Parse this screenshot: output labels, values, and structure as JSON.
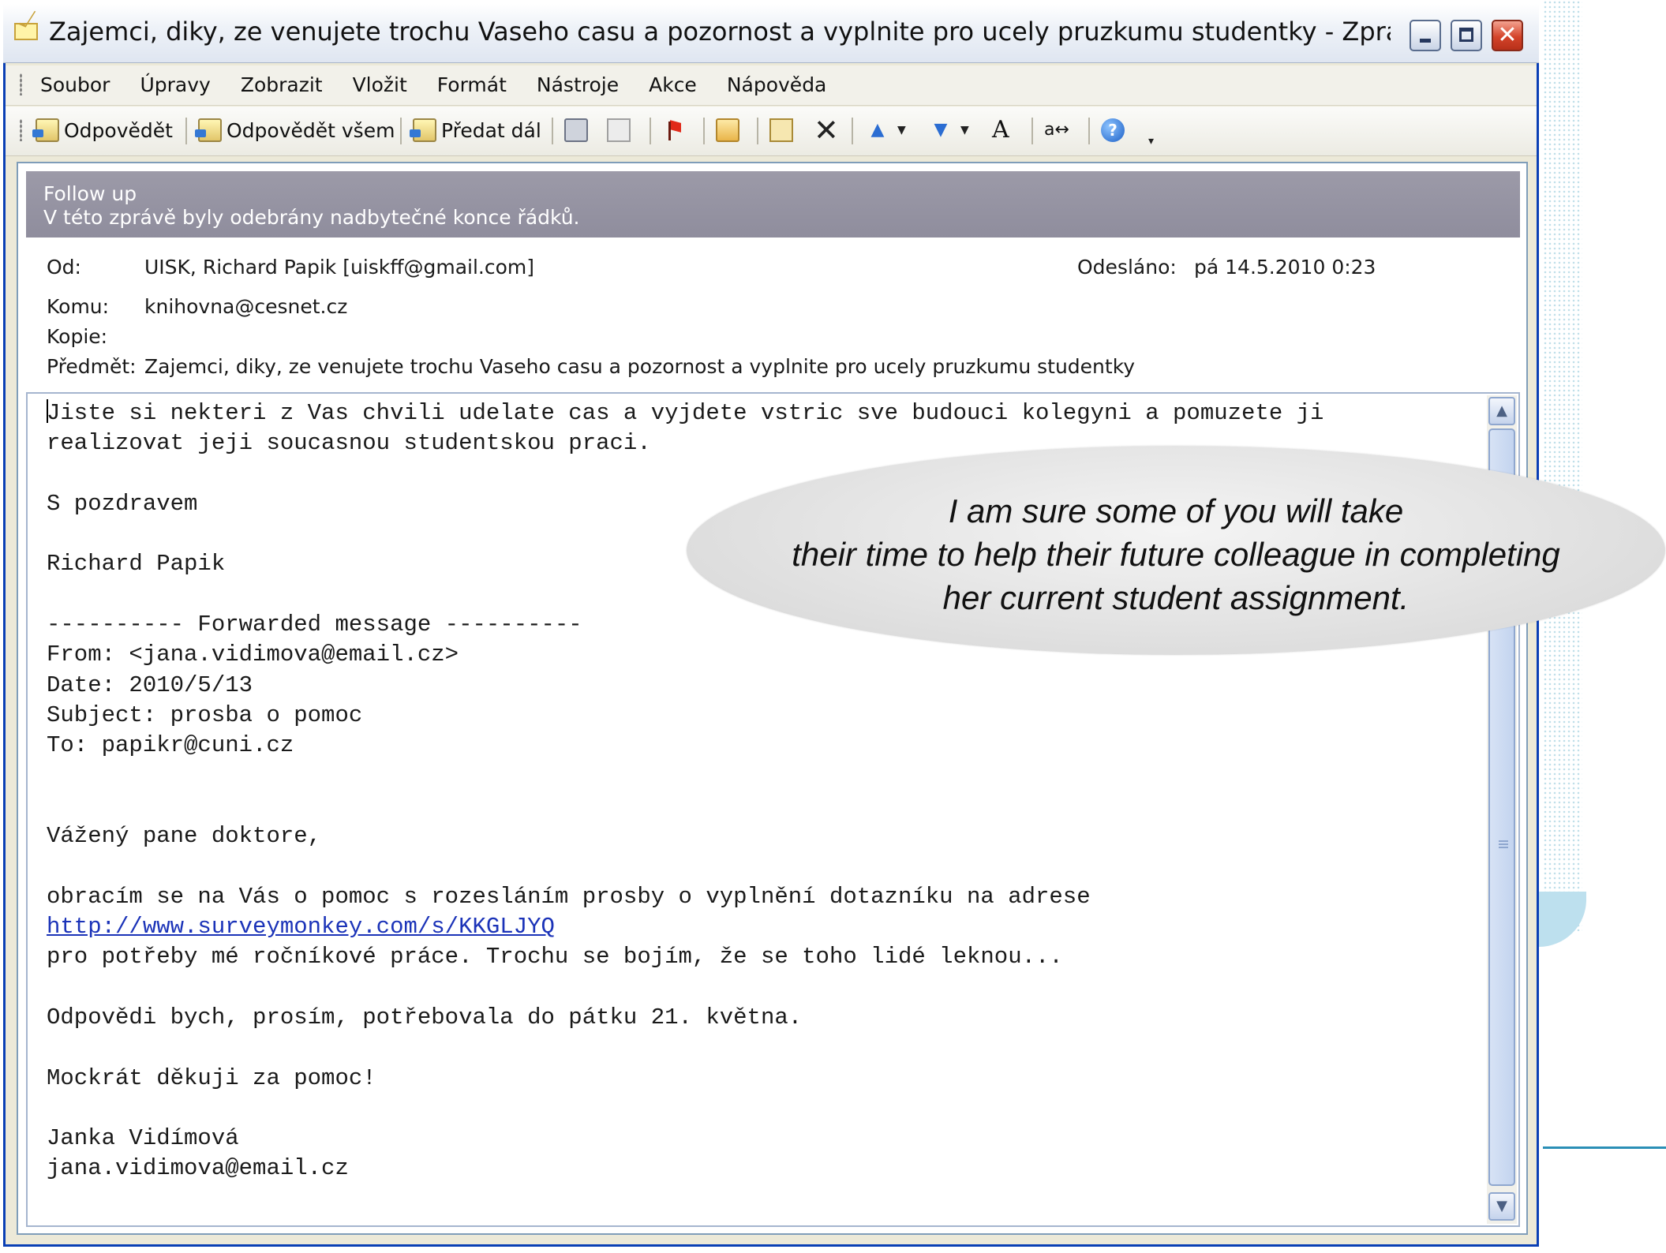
{
  "window": {
    "title": "Zajemci, diky, ze venujete trochu Vaseho casu a pozornost a vyplnite pro ucely pruzkumu studentky - Zpráva (Pr..."
  },
  "menu": [
    "Soubor",
    "Úpravy",
    "Zobrazit",
    "Vložit",
    "Formát",
    "Nástroje",
    "Akce",
    "Nápověda"
  ],
  "toolbar": {
    "reply": "Odpovědět",
    "reply_all": "Odpovědět všem",
    "forward": "Předat dál"
  },
  "infobar": {
    "line1": "Follow up",
    "line2": "V této zprávě byly odebrány nadbytečné konce řádků."
  },
  "header": {
    "from_label": "Od:",
    "from_value": "UISK, Richard Papik [uiskff@gmail.com]",
    "sent_label": "Odesláno:",
    "sent_value": "pá 14.5.2010 0:23",
    "to_label": "Komu:",
    "to_value": "knihovna@cesnet.cz",
    "cc_label": "Kopie:",
    "cc_value": "",
    "subject_label": "Předmět:",
    "subject_value": "Zajemci, diky, ze venujete trochu Vaseho casu a pozornost a vyplnite pro ucely pruzkumu studentky"
  },
  "body": {
    "l1": "Jiste si nekteri z Vas chvili udelate cas a vyjdete vstric sve budouci kolegyni a pomuzete ji",
    "l2": "realizovat jeji soucasnou studentskou praci.",
    "l3": "S pozdravem",
    "l4": "Richard Papik",
    "l5": "---------- Forwarded message ----------",
    "l6": "From: <jana.vidimova@email.cz>",
    "l7": "Date: 2010/5/13",
    "l8": "Subject: prosba o pomoc",
    "l9": "To: papikr@cuni.cz",
    "l10": "Vážený pane doktore,",
    "l11": "obracím se na Vás o pomoc s rozesláním prosby o vyplnění dotazníku na adrese",
    "link": "http://www.surveymonkey.com/s/KKGLJYQ",
    "l12": "pro potřeby mé ročníkové práce. Trochu se bojím, že se toho lidé leknou...",
    "l13": "Odpovědi bych, prosím, potřebovala do pátku 21. května.",
    "l14": "Mockrát děkuji za pomoc!",
    "l15": "Janka Vidímová",
    "l16": "jana.vidimova@email.cz"
  },
  "callout": {
    "line1": "I am sure some of you will take",
    "line2": "their time to help their future colleague in completing",
    "line3": "her current student assignment."
  }
}
